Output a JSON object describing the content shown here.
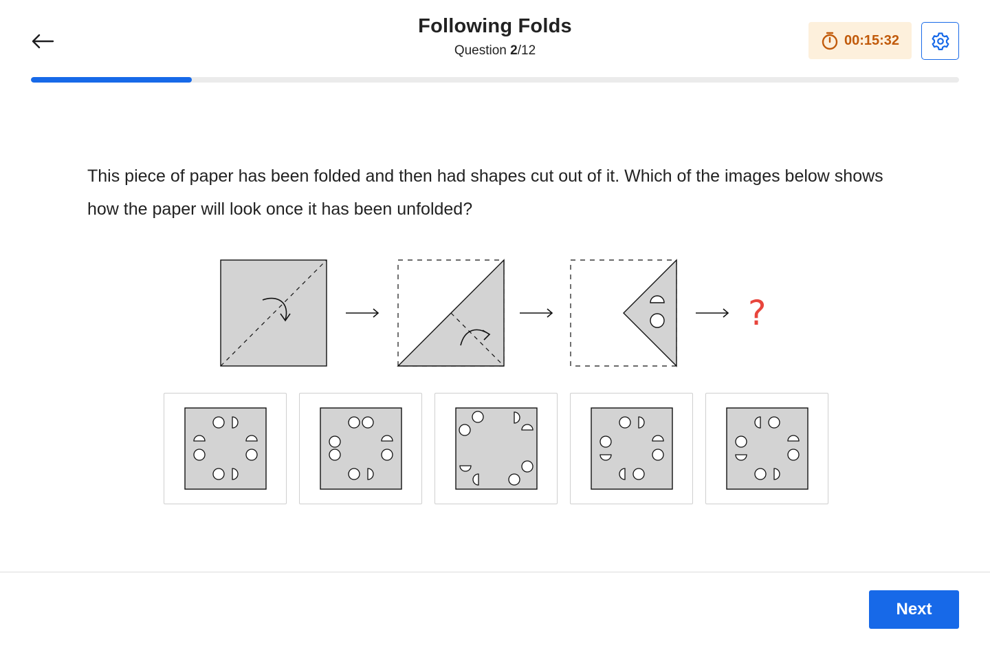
{
  "header": {
    "title": "Following Folds",
    "question_prefix": "Question ",
    "question_current": "2",
    "question_total": "/12",
    "timer": "00:15:32",
    "back_icon": "arrow-left-icon",
    "timer_icon": "stopwatch-icon",
    "settings_icon": "gear-icon"
  },
  "progress": {
    "fraction": 0.1733
  },
  "question": {
    "text": "This piece of paper has been folded and then had shapes cut out of it. Which of the images below shows how the paper will look once it has been unfolded?",
    "unknown_marker": "?"
  },
  "options": [
    {
      "id": "A"
    },
    {
      "id": "B"
    },
    {
      "id": "C"
    },
    {
      "id": "D"
    },
    {
      "id": "E"
    }
  ],
  "footer": {
    "next_label": "Next"
  },
  "colors": {
    "accent": "#1769e8",
    "timer_bg": "#fdf0dc",
    "timer_text": "#c15a0a",
    "paper_fill": "#d3d3d3",
    "question_mark": "#e8453c"
  }
}
